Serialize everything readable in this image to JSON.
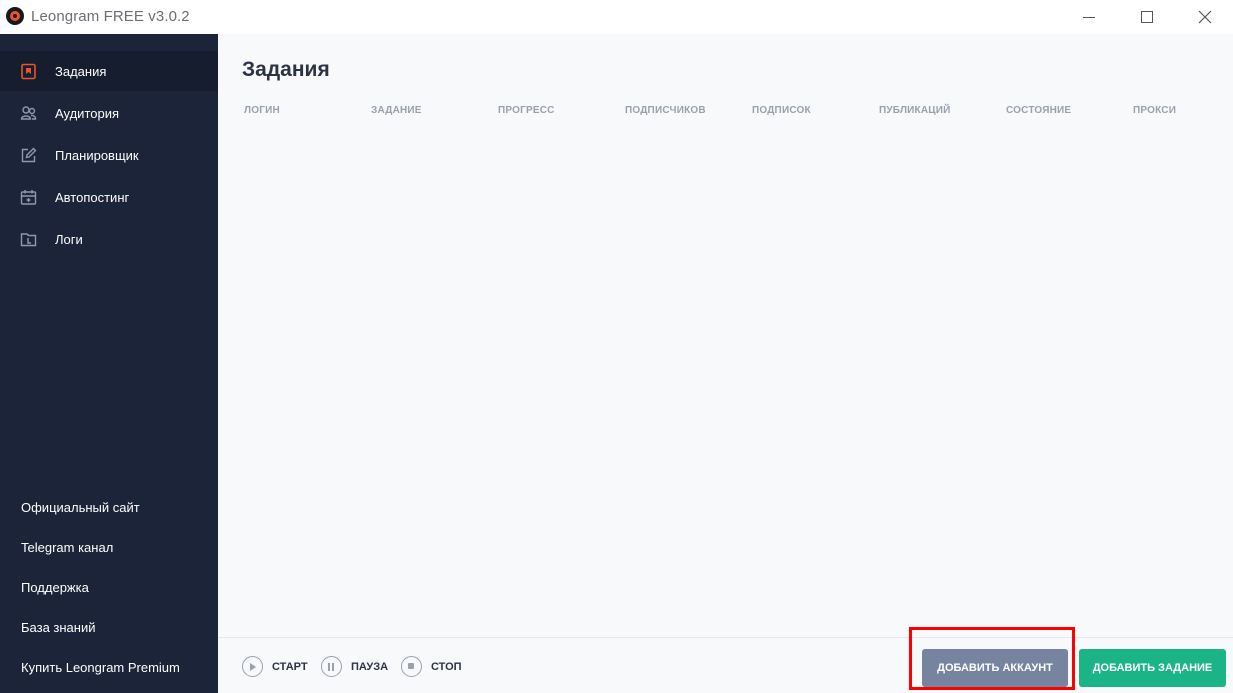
{
  "window": {
    "title": "Leongram FREE v3.0.2"
  },
  "sidebar": {
    "nav": [
      {
        "label": "Задания",
        "icon": "bookmark-icon",
        "active": true
      },
      {
        "label": "Аудитория",
        "icon": "users-icon",
        "active": false
      },
      {
        "label": "Планировщик",
        "icon": "edit-icon",
        "active": false
      },
      {
        "label": "Автопостинг",
        "icon": "calendar-add-icon",
        "active": false
      },
      {
        "label": "Логи",
        "icon": "folder-icon",
        "active": false
      }
    ],
    "links": [
      {
        "label": "Официальный сайт"
      },
      {
        "label": "Telegram канал"
      },
      {
        "label": "Поддержка"
      },
      {
        "label": "База знаний"
      },
      {
        "label": "Купить Leongram Premium"
      }
    ]
  },
  "main": {
    "title": "Задания",
    "columns": [
      "ЛОГИН",
      "ЗАДАНИЕ",
      "ПРОГРЕСС",
      "ПОДПИСЧИКОВ",
      "ПОДПИСОК",
      "ПУБЛИКАЦИЙ",
      "СОСТОЯНИЕ",
      "ПРОКСИ"
    ]
  },
  "footer": {
    "start_label": "СТАРТ",
    "pause_label": "ПАУЗА",
    "stop_label": "СТОП",
    "add_account_label": "ДОБАВИТЬ АККАУНТ",
    "add_task_label": "ДОБАВИТЬ ЗАДАНИЕ"
  },
  "colors": {
    "sidebar_bg": "#1b2438",
    "accent_orange": "#e8562a",
    "add_task_green": "#1bb486",
    "add_account_gray": "#7784a0",
    "highlight_red": "#ff0000"
  }
}
